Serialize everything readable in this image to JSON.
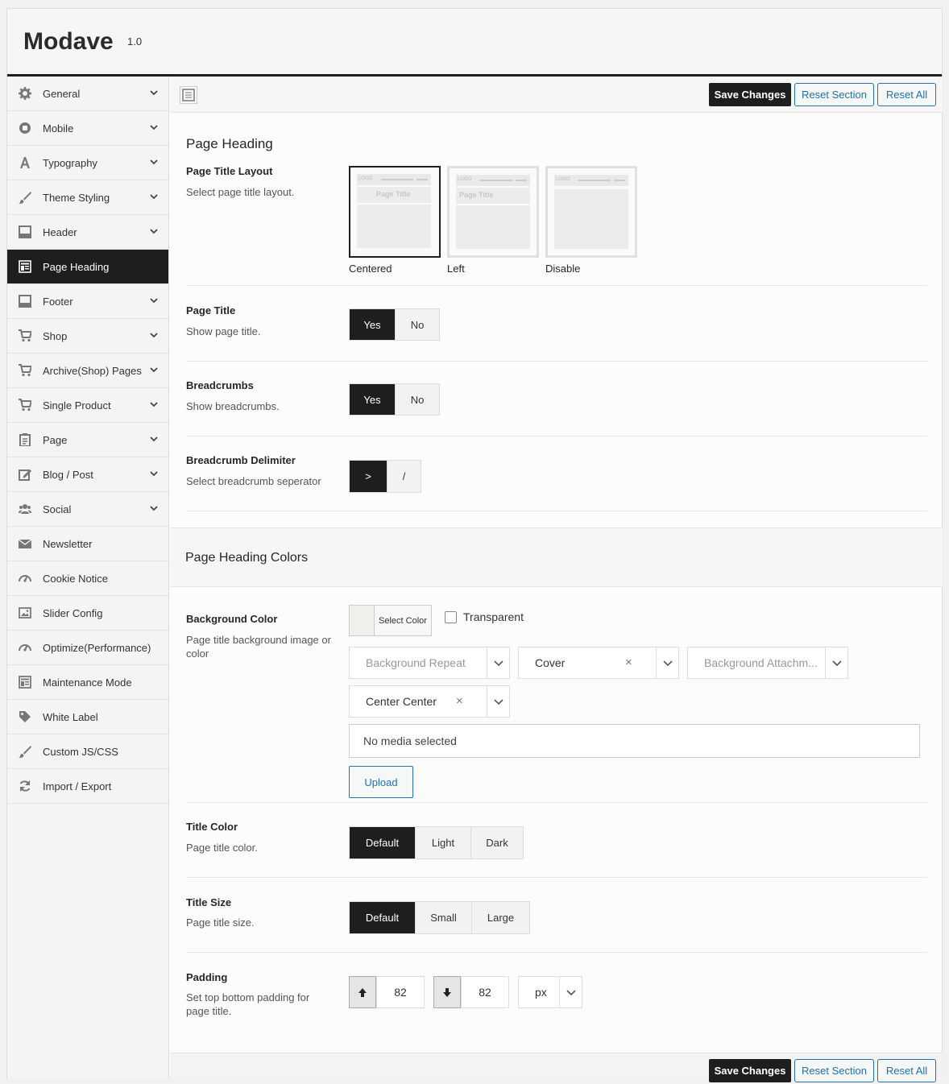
{
  "app": {
    "title": "Modave",
    "version": "1.0"
  },
  "sidebar": {
    "items": [
      {
        "label": "General",
        "icon": "gear-icon",
        "has_children": true
      },
      {
        "label": "Mobile",
        "icon": "mobile-circle-icon",
        "has_children": true
      },
      {
        "label": "Typography",
        "icon": "font-icon",
        "has_children": true
      },
      {
        "label": "Theme Styling",
        "icon": "brush-icon",
        "has_children": true
      },
      {
        "label": "Header",
        "icon": "header-layout-icon",
        "has_children": true
      },
      {
        "label": "Page Heading",
        "icon": "page-heading-icon",
        "has_children": false,
        "active": true
      },
      {
        "label": "Footer",
        "icon": "footer-layout-icon",
        "has_children": true
      },
      {
        "label": "Shop",
        "icon": "cart-icon",
        "has_children": true
      },
      {
        "label": "Archive(Shop) Pages",
        "icon": "cart-icon",
        "has_children": true
      },
      {
        "label": "Single Product",
        "icon": "cart-icon",
        "has_children": true
      },
      {
        "label": "Page",
        "icon": "clipboard-icon",
        "has_children": true
      },
      {
        "label": "Blog / Post",
        "icon": "edit-icon",
        "has_children": true
      },
      {
        "label": "Social",
        "icon": "users-icon",
        "has_children": true
      },
      {
        "label": "Newsletter",
        "icon": "envelope-icon",
        "has_children": false
      },
      {
        "label": "Cookie Notice",
        "icon": "dashboard-icon",
        "has_children": false
      },
      {
        "label": "Slider Config",
        "icon": "image-icon",
        "has_children": false
      },
      {
        "label": "Optimize(Performance)",
        "icon": "dashboard-icon",
        "has_children": false
      },
      {
        "label": "Maintenance Mode",
        "icon": "layout-icon",
        "has_children": false
      },
      {
        "label": "White Label",
        "icon": "tag-icon",
        "has_children": false
      },
      {
        "label": "Custom JS/CSS",
        "icon": "brush-icon",
        "has_children": false
      },
      {
        "label": "Import / Export",
        "icon": "refresh-icon",
        "has_children": false
      }
    ]
  },
  "toolbar": {
    "save_label": "Save Changes",
    "reset_section_label": "Reset Section",
    "reset_all_label": "Reset All"
  },
  "section1": {
    "title": "Page Heading",
    "layout": {
      "label": "Page Title Layout",
      "desc": "Select page title layout.",
      "options": [
        {
          "caption": "Centered",
          "preview_title": "Page Title",
          "logo": "LOGO",
          "selected": true
        },
        {
          "caption": "Left",
          "preview_title": "Page Title",
          "logo": "LOGO"
        },
        {
          "caption": "Disable",
          "preview_title": "",
          "logo": "LOGO"
        }
      ]
    },
    "page_title": {
      "label": "Page Title",
      "desc": "Show page title.",
      "yes": "Yes",
      "no": "No"
    },
    "breadcrumbs": {
      "label": "Breadcrumbs",
      "desc": "Show breadcrumbs.",
      "yes": "Yes",
      "no": "No"
    },
    "delimiter": {
      "label": "Breadcrumb Delimiter",
      "desc": "Select breadcrumb seperator",
      "opt1": ">",
      "opt2": "/"
    }
  },
  "section2": {
    "title": "Page Heading Colors",
    "bg": {
      "label": "Background Color",
      "desc": "Page title background image or color",
      "select_color": "Select Color",
      "transparent": "Transparent",
      "repeat_placeholder": "Background Repeat",
      "size_value": "Cover",
      "attachment_placeholder": "Background Attachm...",
      "position_value": "Center Center",
      "media_placeholder": "No media selected",
      "upload_label": "Upload"
    },
    "title_color": {
      "label": "Title Color",
      "desc": "Page title color.",
      "opt1": "Default",
      "opt2": "Light",
      "opt3": "Dark"
    },
    "title_size": {
      "label": "Title Size",
      "desc": "Page title size.",
      "opt1": "Default",
      "opt2": "Small",
      "opt3": "Large"
    },
    "padding": {
      "label": "Padding",
      "desc": "Set top bottom padding for page title.",
      "top": "82",
      "bottom": "82",
      "unit": "px"
    }
  },
  "colors": {
    "accent": "#1e1e1e",
    "link": "#2271b1"
  }
}
